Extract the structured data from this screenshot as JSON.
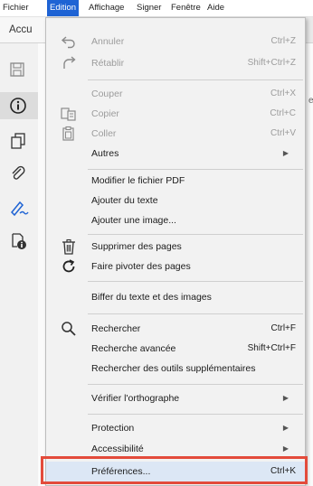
{
  "menubar": {
    "items": [
      "Fichier",
      "Edition",
      "Affichage",
      "Signer",
      "Fenêtre",
      "Aide"
    ]
  },
  "app": {
    "tab_label": "Accu",
    "stray_text": "e"
  },
  "menu": {
    "annuler": {
      "label": "Annuler",
      "shortcut": "Ctrl+Z"
    },
    "retablir": {
      "label": "Rétablir",
      "shortcut": "Shift+Ctrl+Z"
    },
    "couper": {
      "label": "Couper",
      "shortcut": "Ctrl+X"
    },
    "copier": {
      "label": "Copier",
      "shortcut": "Ctrl+C"
    },
    "coller": {
      "label": "Coller",
      "shortcut": "Ctrl+V"
    },
    "autres": {
      "label": "Autres"
    },
    "modifier": {
      "label": "Modifier le fichier PDF"
    },
    "ajouter_texte": {
      "label": "Ajouter du texte"
    },
    "ajouter_image": {
      "label": "Ajouter une image..."
    },
    "supprimer": {
      "label": "Supprimer des pages"
    },
    "pivoter": {
      "label": "Faire pivoter des pages"
    },
    "biffer": {
      "label": "Biffer du texte et des images"
    },
    "rechercher": {
      "label": "Rechercher",
      "shortcut": "Ctrl+F"
    },
    "recherche_avancee": {
      "label": "Recherche avancée",
      "shortcut": "Shift+Ctrl+F"
    },
    "rechercher_outils": {
      "label": "Rechercher des outils supplémentaires"
    },
    "orthographe": {
      "label": "Vérifier l'orthographe"
    },
    "protection": {
      "label": "Protection"
    },
    "accessibilite": {
      "label": "Accessibilité"
    },
    "preferences": {
      "label": "Préférences...",
      "shortcut": "Ctrl+K"
    }
  },
  "colors": {
    "accent": "#1e63d4",
    "highlight_border": "#e34b3b",
    "hover_bg": "#dce7f5"
  }
}
